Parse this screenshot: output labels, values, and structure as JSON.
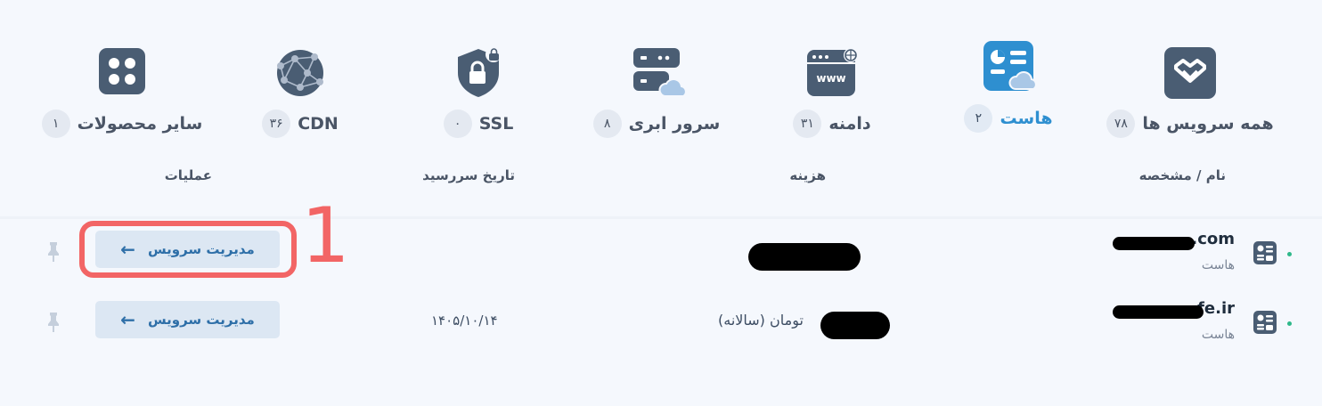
{
  "tabs": [
    {
      "name": "همه سرویس ها",
      "count": "۷۸",
      "icon": "hearts-icon",
      "active": false
    },
    {
      "name": "هاست",
      "count": "۲",
      "icon": "host-chart-icon",
      "active": true
    },
    {
      "name": "دامنه",
      "count": "۳۱",
      "icon": "www-icon",
      "active": false
    },
    {
      "name": "سرور ابری",
      "count": "۸",
      "icon": "cloud-server-icon",
      "active": false
    },
    {
      "name": "SSL",
      "count": "۰",
      "icon": "ssl-lock-icon",
      "active": false
    },
    {
      "name": "CDN",
      "count": "۳۶",
      "icon": "network-globe-icon",
      "active": false
    },
    {
      "name": "سایر محصولات",
      "count": "۱",
      "icon": "grid-icon",
      "active": false
    }
  ],
  "table": {
    "headers": {
      "name": "نام / مشخصه",
      "cost": "هزینه",
      "due": "تاریخ سررسید",
      "actions": "عملیات"
    },
    "rows": [
      {
        "service": ".com",
        "type": "هاست",
        "price": "",
        "due": "",
        "button": "مدیریت سرویس"
      },
      {
        "service": "fe.ir",
        "type": "هاست",
        "price": "تومان  (سالانه)",
        "due": "۱۴۰۵/۱۰/۱۴",
        "button": "مدیریت سرویس"
      }
    ]
  },
  "annotation": {
    "number": "1"
  },
  "colors": {
    "accent": "#2e8fd0",
    "icon": "#4a5d73",
    "button_bg": "#dce7f3",
    "annotation": "#f26565",
    "background": "#f5f8fd"
  }
}
